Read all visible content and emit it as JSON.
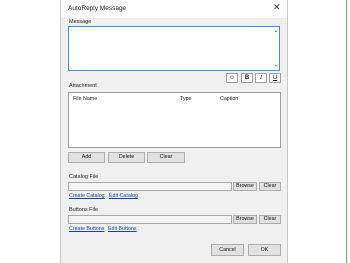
{
  "window": {
    "title": "AutoReply Message",
    "close_glyph": "✕"
  },
  "message": {
    "label": "Message",
    "value": ""
  },
  "toolbar": {
    "items": [
      {
        "icon": "smiley-icon",
        "glyph": "☺"
      },
      {
        "icon": "bold-icon",
        "glyph": "B"
      },
      {
        "icon": "italic-icon",
        "glyph": "I"
      },
      {
        "icon": "underline-icon",
        "glyph": "U"
      }
    ]
  },
  "attachment": {
    "label": "Attachment",
    "columns": [
      "File Name",
      "Type",
      "Caption"
    ],
    "rows": [],
    "buttons": {
      "add": "Add",
      "delete": "Delete",
      "clear": "Clear"
    }
  },
  "catalog": {
    "label": "Catalog File",
    "value": "",
    "browse": "Browse",
    "clear": "Clear",
    "create_link": "Create Catalog",
    "edit_link": "Edit Catalog"
  },
  "buttons_file": {
    "label": "Buttons File",
    "value": "",
    "browse": "Browse",
    "clear": "Clear",
    "create_link": "Create Buttons",
    "edit_link": "Edit Buttons"
  },
  "footer": {
    "cancel": "Cancel",
    "ok": "OK"
  },
  "colors": {
    "focus_border": "#3c8fd8",
    "link": "#1a3fb0",
    "dialog_bg": "#f0f0f0",
    "side_accent": "#6fb04a"
  }
}
